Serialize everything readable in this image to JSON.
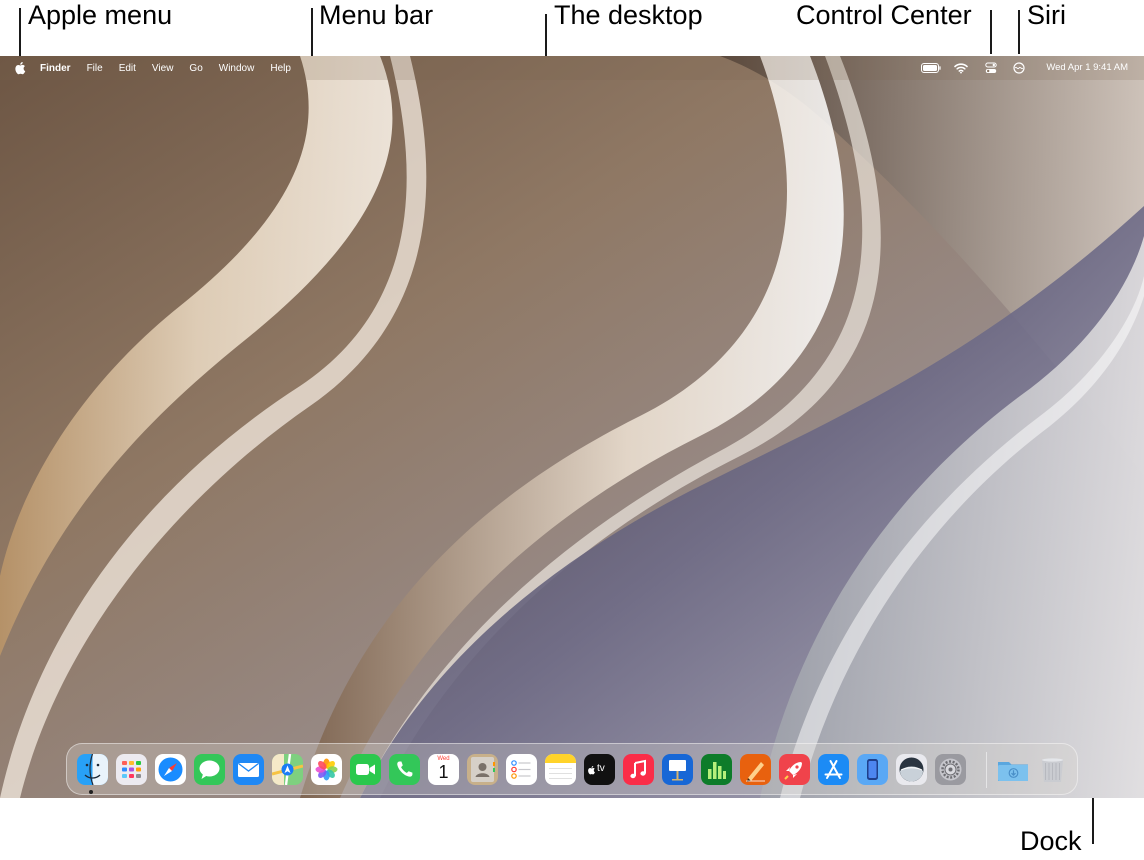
{
  "callouts": {
    "apple_menu": "Apple menu",
    "menu_bar": "Menu bar",
    "desktop": "The desktop",
    "control_center": "Control Center",
    "siri": "Siri",
    "dock": "Dock"
  },
  "menubar": {
    "app_name": "Finder",
    "items": [
      "File",
      "Edit",
      "View",
      "Go",
      "Window",
      "Help"
    ],
    "clock": "Wed Apr 1  9:41 AM"
  },
  "status_icons": [
    "battery-icon",
    "wifi-icon",
    "control-center-icon",
    "siri-icon"
  ],
  "dock": {
    "apps": [
      {
        "id": "finder",
        "icon": "finder-icon",
        "color": "#1e8ff5"
      },
      {
        "id": "launchpad",
        "icon": "launchpad-icon",
        "color": "#e9e9ee"
      },
      {
        "id": "safari",
        "icon": "safari-icon",
        "color": "#1a84ff"
      },
      {
        "id": "messages",
        "icon": "messages-icon",
        "color": "#35c759"
      },
      {
        "id": "mail",
        "icon": "mail-icon",
        "color": "#1e88f5"
      },
      {
        "id": "maps",
        "icon": "maps-icon",
        "color": "#5cc36a"
      },
      {
        "id": "photos",
        "icon": "photos-icon",
        "color": "#ffffff"
      },
      {
        "id": "facetime",
        "icon": "facetime-icon",
        "color": "#2bc84d"
      },
      {
        "id": "phone",
        "icon": "phone-icon",
        "color": "#33c759"
      },
      {
        "id": "calendar",
        "icon": "calendar-icon",
        "color": "#ffffff",
        "day": "Wed",
        "date": "1"
      },
      {
        "id": "contacts",
        "icon": "contacts-icon",
        "color": "#c8b08a"
      },
      {
        "id": "reminders",
        "icon": "reminders-icon",
        "color": "#ffffff"
      },
      {
        "id": "notes",
        "icon": "notes-icon",
        "color": "#ffffff"
      },
      {
        "id": "tv",
        "icon": "apple-tv-icon",
        "color": "#111111",
        "label": "tv"
      },
      {
        "id": "music",
        "icon": "music-icon",
        "color": "#fa2d48"
      },
      {
        "id": "keynote",
        "icon": "keynote-icon",
        "color": "#1767d6"
      },
      {
        "id": "numbers",
        "icon": "numbers-icon",
        "color": "#1e9e33"
      },
      {
        "id": "pages",
        "icon": "pages-icon",
        "color": "#f07a12"
      },
      {
        "id": "games",
        "icon": "games-icon",
        "color": "#f0434b"
      },
      {
        "id": "app-store",
        "icon": "app-store-icon",
        "color": "#1c8bf5"
      },
      {
        "id": "iphone-mirroring",
        "icon": "iphone-mirroring-icon",
        "color": "#2f6fe4"
      },
      {
        "id": "macos",
        "icon": "macos-icon",
        "color": "#5b6b7b"
      },
      {
        "id": "system-settings",
        "icon": "gear-icon",
        "color": "#9a9aa0"
      }
    ],
    "extras": [
      {
        "id": "downloads",
        "icon": "downloads-folder-icon",
        "color": "#6fb7ea"
      },
      {
        "id": "trash",
        "icon": "trash-icon",
        "color": "#c9cbd0"
      }
    ]
  }
}
